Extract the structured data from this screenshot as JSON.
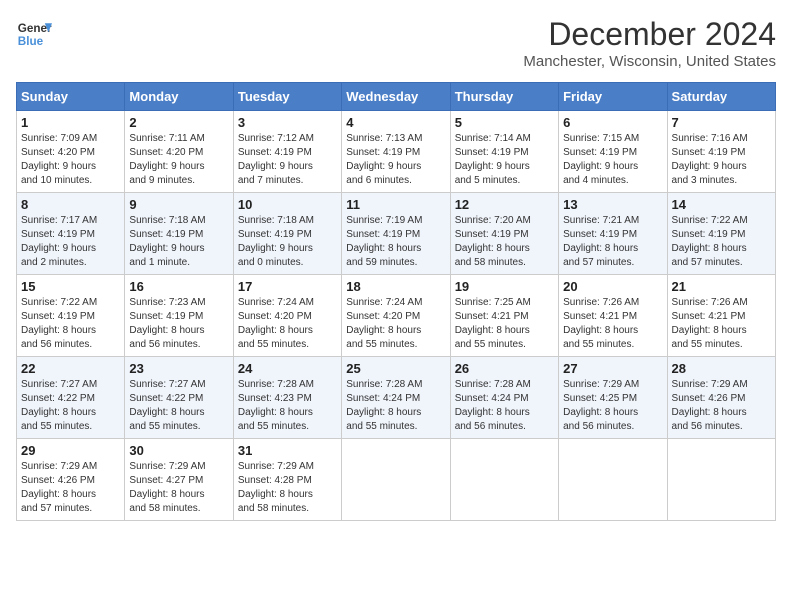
{
  "header": {
    "logo_line1": "General",
    "logo_line2": "Blue",
    "title": "December 2024",
    "subtitle": "Manchester, Wisconsin, United States"
  },
  "days_of_week": [
    "Sunday",
    "Monday",
    "Tuesday",
    "Wednesday",
    "Thursday",
    "Friday",
    "Saturday"
  ],
  "weeks": [
    [
      {
        "day": "1",
        "lines": [
          "Sunrise: 7:09 AM",
          "Sunset: 4:20 PM",
          "Daylight: 9 hours",
          "and 10 minutes."
        ]
      },
      {
        "day": "2",
        "lines": [
          "Sunrise: 7:11 AM",
          "Sunset: 4:20 PM",
          "Daylight: 9 hours",
          "and 9 minutes."
        ]
      },
      {
        "day": "3",
        "lines": [
          "Sunrise: 7:12 AM",
          "Sunset: 4:19 PM",
          "Daylight: 9 hours",
          "and 7 minutes."
        ]
      },
      {
        "day": "4",
        "lines": [
          "Sunrise: 7:13 AM",
          "Sunset: 4:19 PM",
          "Daylight: 9 hours",
          "and 6 minutes."
        ]
      },
      {
        "day": "5",
        "lines": [
          "Sunrise: 7:14 AM",
          "Sunset: 4:19 PM",
          "Daylight: 9 hours",
          "and 5 minutes."
        ]
      },
      {
        "day": "6",
        "lines": [
          "Sunrise: 7:15 AM",
          "Sunset: 4:19 PM",
          "Daylight: 9 hours",
          "and 4 minutes."
        ]
      },
      {
        "day": "7",
        "lines": [
          "Sunrise: 7:16 AM",
          "Sunset: 4:19 PM",
          "Daylight: 9 hours",
          "and 3 minutes."
        ]
      }
    ],
    [
      {
        "day": "8",
        "lines": [
          "Sunrise: 7:17 AM",
          "Sunset: 4:19 PM",
          "Daylight: 9 hours",
          "and 2 minutes."
        ]
      },
      {
        "day": "9",
        "lines": [
          "Sunrise: 7:18 AM",
          "Sunset: 4:19 PM",
          "Daylight: 9 hours",
          "and 1 minute."
        ]
      },
      {
        "day": "10",
        "lines": [
          "Sunrise: 7:18 AM",
          "Sunset: 4:19 PM",
          "Daylight: 9 hours",
          "and 0 minutes."
        ]
      },
      {
        "day": "11",
        "lines": [
          "Sunrise: 7:19 AM",
          "Sunset: 4:19 PM",
          "Daylight: 8 hours",
          "and 59 minutes."
        ]
      },
      {
        "day": "12",
        "lines": [
          "Sunrise: 7:20 AM",
          "Sunset: 4:19 PM",
          "Daylight: 8 hours",
          "and 58 minutes."
        ]
      },
      {
        "day": "13",
        "lines": [
          "Sunrise: 7:21 AM",
          "Sunset: 4:19 PM",
          "Daylight: 8 hours",
          "and 57 minutes."
        ]
      },
      {
        "day": "14",
        "lines": [
          "Sunrise: 7:22 AM",
          "Sunset: 4:19 PM",
          "Daylight: 8 hours",
          "and 57 minutes."
        ]
      }
    ],
    [
      {
        "day": "15",
        "lines": [
          "Sunrise: 7:22 AM",
          "Sunset: 4:19 PM",
          "Daylight: 8 hours",
          "and 56 minutes."
        ]
      },
      {
        "day": "16",
        "lines": [
          "Sunrise: 7:23 AM",
          "Sunset: 4:19 PM",
          "Daylight: 8 hours",
          "and 56 minutes."
        ]
      },
      {
        "day": "17",
        "lines": [
          "Sunrise: 7:24 AM",
          "Sunset: 4:20 PM",
          "Daylight: 8 hours",
          "and 55 minutes."
        ]
      },
      {
        "day": "18",
        "lines": [
          "Sunrise: 7:24 AM",
          "Sunset: 4:20 PM",
          "Daylight: 8 hours",
          "and 55 minutes."
        ]
      },
      {
        "day": "19",
        "lines": [
          "Sunrise: 7:25 AM",
          "Sunset: 4:21 PM",
          "Daylight: 8 hours",
          "and 55 minutes."
        ]
      },
      {
        "day": "20",
        "lines": [
          "Sunrise: 7:26 AM",
          "Sunset: 4:21 PM",
          "Daylight: 8 hours",
          "and 55 minutes."
        ]
      },
      {
        "day": "21",
        "lines": [
          "Sunrise: 7:26 AM",
          "Sunset: 4:21 PM",
          "Daylight: 8 hours",
          "and 55 minutes."
        ]
      }
    ],
    [
      {
        "day": "22",
        "lines": [
          "Sunrise: 7:27 AM",
          "Sunset: 4:22 PM",
          "Daylight: 8 hours",
          "and 55 minutes."
        ]
      },
      {
        "day": "23",
        "lines": [
          "Sunrise: 7:27 AM",
          "Sunset: 4:22 PM",
          "Daylight: 8 hours",
          "and 55 minutes."
        ]
      },
      {
        "day": "24",
        "lines": [
          "Sunrise: 7:28 AM",
          "Sunset: 4:23 PM",
          "Daylight: 8 hours",
          "and 55 minutes."
        ]
      },
      {
        "day": "25",
        "lines": [
          "Sunrise: 7:28 AM",
          "Sunset: 4:24 PM",
          "Daylight: 8 hours",
          "and 55 minutes."
        ]
      },
      {
        "day": "26",
        "lines": [
          "Sunrise: 7:28 AM",
          "Sunset: 4:24 PM",
          "Daylight: 8 hours",
          "and 56 minutes."
        ]
      },
      {
        "day": "27",
        "lines": [
          "Sunrise: 7:29 AM",
          "Sunset: 4:25 PM",
          "Daylight: 8 hours",
          "and 56 minutes."
        ]
      },
      {
        "day": "28",
        "lines": [
          "Sunrise: 7:29 AM",
          "Sunset: 4:26 PM",
          "Daylight: 8 hours",
          "and 56 minutes."
        ]
      }
    ],
    [
      {
        "day": "29",
        "lines": [
          "Sunrise: 7:29 AM",
          "Sunset: 4:26 PM",
          "Daylight: 8 hours",
          "and 57 minutes."
        ]
      },
      {
        "day": "30",
        "lines": [
          "Sunrise: 7:29 AM",
          "Sunset: 4:27 PM",
          "Daylight: 8 hours",
          "and 58 minutes."
        ]
      },
      {
        "day": "31",
        "lines": [
          "Sunrise: 7:29 AM",
          "Sunset: 4:28 PM",
          "Daylight: 8 hours",
          "and 58 minutes."
        ]
      },
      {
        "day": "",
        "lines": []
      },
      {
        "day": "",
        "lines": []
      },
      {
        "day": "",
        "lines": []
      },
      {
        "day": "",
        "lines": []
      }
    ]
  ]
}
